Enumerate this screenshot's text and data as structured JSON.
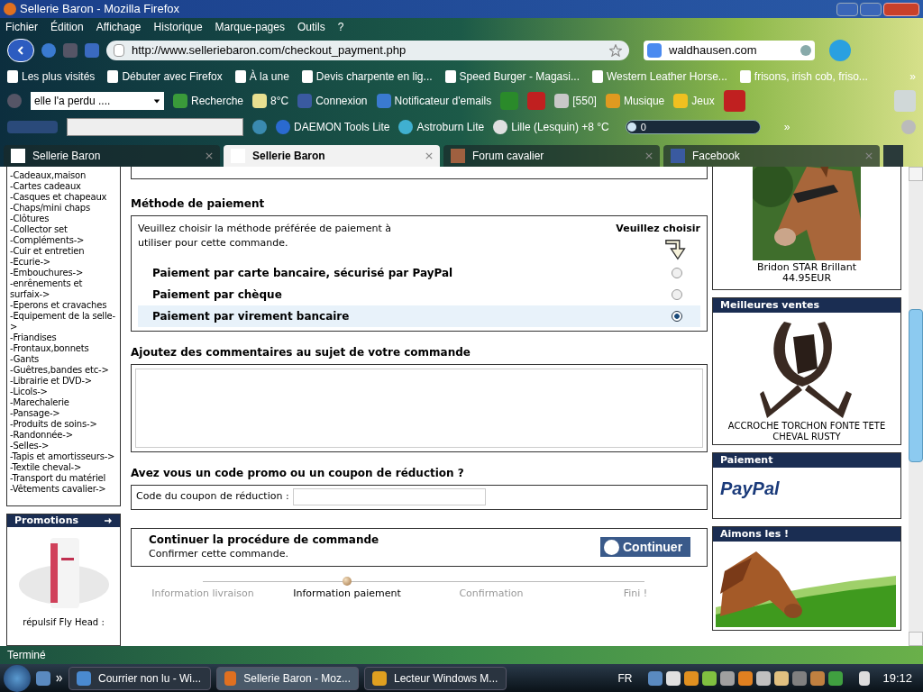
{
  "window": {
    "title": "Sellerie Baron - Mozilla Firefox"
  },
  "menu": [
    "Fichier",
    "Édition",
    "Affichage",
    "Historique",
    "Marque-pages",
    "Outils",
    "?"
  ],
  "address_bar": {
    "url": "http://www.selleriebaron.com/checkout_payment.php"
  },
  "search_bar": {
    "value": "waldhausen.com"
  },
  "bookmarks": [
    "Les plus visités",
    "Débuter avec Firefox",
    "À la une",
    "Devis charpente en lig...",
    "Speed Burger - Magasi...",
    "Western Leather Horse...",
    "frisons, irish cob, friso..."
  ],
  "bookmarks_more": "»",
  "toolbar_1": {
    "search_value": "elle l'a perdu ....",
    "labels": [
      "Recherche",
      "8°C",
      "Connexion",
      "Notificateur d'emails",
      "[550]",
      "Musique",
      "Jeux"
    ]
  },
  "toolbar_2": {
    "labels": [
      "DAEMON Tools Lite",
      "Astroburn Lite",
      "Lille (Lesquin) +8 °C"
    ],
    "player": {
      "value": "0",
      "level": 0
    },
    "more": "»"
  },
  "tabs": [
    {
      "label": "Sellerie Baron",
      "selected": false
    },
    {
      "label": "Sellerie Baron",
      "selected": true
    },
    {
      "label": "Forum cavalier",
      "selected": false
    },
    {
      "label": "Facebook",
      "selected": false
    }
  ],
  "categories": [
    "-Cadeaux,maison",
    "-Cartes cadeaux",
    "-Casques et chapeaux",
    "-Chaps/mini chaps",
    "-Clôtures",
    "-Collector set",
    "-Compléments->",
    "-Cuir et entretien",
    "-Ecurie->",
    "-Embouchures->",
    "-enrênements et surfaix->",
    "-Eperons et cravaches",
    "-Equipement de la selle->",
    "-Friandises",
    "-Frontaux,bonnets",
    "-Gants",
    "-Guêtres,bandes etc->",
    "-Librairie et DVD->",
    "-Licols->",
    "-Marechalerie",
    "-Pansage->",
    "-Produits de soins->",
    "-Randonnée->",
    "-Selles->",
    "-Tapis et amortisseurs->",
    "-Textile cheval->",
    "-Transport du matériel",
    "-Vêtements cavalier->"
  ],
  "promotions": {
    "title": "Promotions",
    "product": "répulsif Fly Head :"
  },
  "payment": {
    "title": "Méthode de paiement",
    "intro": "Veuillez choisir la méthode préférée de paiement à utiliser pour cette commande.",
    "prompt": "Veuillez choisir",
    "options": [
      {
        "label": "Paiement par carte bancaire, sécurisé par PayPal",
        "selected": false
      },
      {
        "label": "Paiement par chèque",
        "selected": false
      },
      {
        "label": "Paiement par virement bancaire",
        "selected": true
      }
    ]
  },
  "comments": {
    "title": "Ajoutez des commentaires au sujet de votre commande"
  },
  "coupon": {
    "title": "Avez vous un code promo ou un coupon de réduction ?",
    "label": "Code du coupon de réduction :"
  },
  "continue": {
    "title": "Continuer la procédure de commande",
    "subtitle": "Confirmer cette commande.",
    "button": "Continuer"
  },
  "steps": [
    {
      "label": "Information livraison",
      "selected": false
    },
    {
      "label": "Information paiement",
      "selected": true
    },
    {
      "label": "Confirmation",
      "selected": false
    },
    {
      "label": "Fini !",
      "selected": false
    }
  ],
  "featured": {
    "name": "Bridon STAR Brillant",
    "price": "44.95EUR"
  },
  "bestsellers": {
    "title": "Meilleures ventes",
    "product": "ACCROCHE TORCHON FONTE TETE CHEVAL RUSTY"
  },
  "payment_box": {
    "title": "Paiement",
    "logo": "PayPal"
  },
  "ad_box": {
    "title": "Aimons les !"
  },
  "status_bar": "Terminé",
  "taskbar": {
    "items": [
      "Courrier non lu - Wi...",
      "Sellerie Baron - Moz...",
      "Lecteur Windows M..."
    ],
    "language": "FR",
    "clock": "19:12"
  }
}
